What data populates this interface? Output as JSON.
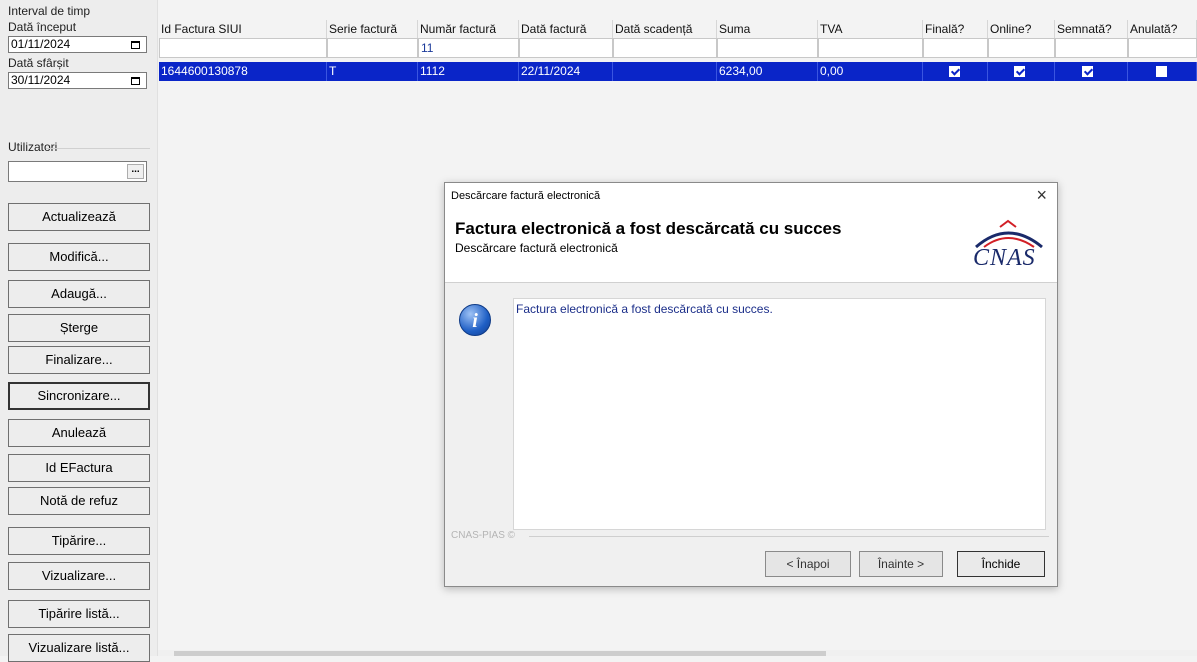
{
  "left_panel": {
    "interval_label": "Interval de timp",
    "start_label": "Dată început",
    "start_value": "01/11/2024",
    "end_label": "Dată sfârșit",
    "end_value": "30/11/2024",
    "users_label": "Utilizatori",
    "users_value": "",
    "users_browse": "...",
    "buttons": [
      "Actualizează",
      "Modifică...",
      "Adaugă...",
      "Șterge",
      "Finalizare...",
      "Sincronizare...",
      "Anulează",
      "Id EFactura",
      "Notă de refuz",
      "Tipărire...",
      "Vizualizare...",
      "Tipărire listă...",
      "Vizualizare listă..."
    ]
  },
  "grid": {
    "columns": [
      "Id Factura SIUI",
      "Serie factură",
      "Număr factură",
      "Dată factură",
      "Dată scadență",
      "Suma",
      "TVA",
      "Finală?",
      "Online?",
      "Semnată?",
      "Anulată?"
    ],
    "filters": [
      "",
      "",
      "11",
      "",
      "",
      "",
      "",
      "",
      "",
      "",
      ""
    ],
    "rows": [
      {
        "id": "1644600130878",
        "serie": "T",
        "numar": "1112",
        "data": "22/11/2024",
        "scadenta": "",
        "suma": "6234,00",
        "tva": "0,00",
        "finala": true,
        "online": true,
        "semnata": true,
        "anulata": false
      }
    ]
  },
  "dialog": {
    "title": "Descărcare factură electronică",
    "close": "×",
    "heading": "Factura electronică a fost descărcată cu succes",
    "subheading": "Descărcare factură electronică",
    "logo_text": "CNAS",
    "message": "Factura electronică a fost descărcată cu succes.",
    "footer": "CNAS-PIAS ©",
    "btn_back": "< Înapoi",
    "btn_next": "Înainte >",
    "btn_close": "Închide"
  },
  "colors": {
    "selection": "#0a25c8",
    "message_text": "#1c2f8a"
  }
}
